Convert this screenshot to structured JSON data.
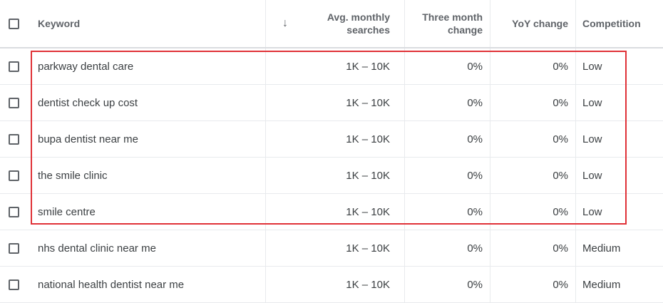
{
  "columns": {
    "keyword": "Keyword",
    "sort_icon": "↓",
    "avg_line1": "Avg. monthly",
    "avg_line2": "searches",
    "three_line1": "Three month",
    "three_line2": "change",
    "yoy": "YoY change",
    "competition": "Competition"
  },
  "rows": [
    {
      "keyword": "parkway dental care",
      "avg": "1K – 10K",
      "three": "0%",
      "yoy": "0%",
      "competition": "Low"
    },
    {
      "keyword": "dentist check up cost",
      "avg": "1K – 10K",
      "three": "0%",
      "yoy": "0%",
      "competition": "Low"
    },
    {
      "keyword": "bupa dentist near me",
      "avg": "1K – 10K",
      "three": "0%",
      "yoy": "0%",
      "competition": "Low"
    },
    {
      "keyword": "the smile clinic",
      "avg": "1K – 10K",
      "three": "0%",
      "yoy": "0%",
      "competition": "Low"
    },
    {
      "keyword": "smile centre",
      "avg": "1K – 10K",
      "three": "0%",
      "yoy": "0%",
      "competition": "Low"
    },
    {
      "keyword": "nhs dental clinic near me",
      "avg": "1K – 10K",
      "three": "0%",
      "yoy": "0%",
      "competition": "Medium"
    },
    {
      "keyword": "national health dentist near me",
      "avg": "1K – 10K",
      "three": "0%",
      "yoy": "0%",
      "competition": "Medium"
    }
  ],
  "colors": {
    "highlight_border": "#e03137",
    "text": "#3c4043",
    "header_text": "#5f6368"
  }
}
